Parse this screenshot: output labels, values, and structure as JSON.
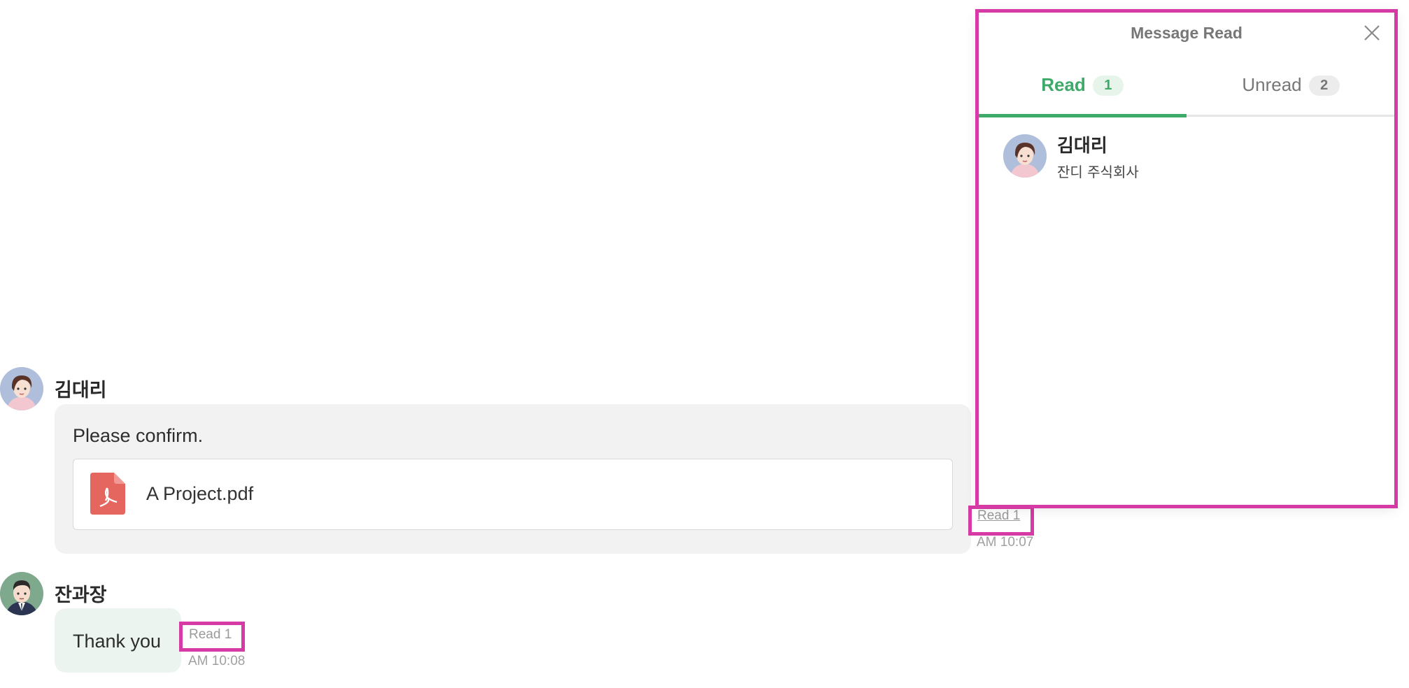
{
  "messages": [
    {
      "sender": "김대리",
      "text": "Please confirm.",
      "attachment": {
        "file_name": "A Project.pdf",
        "icon": "pdf-file-icon"
      },
      "read_label": "Read 1",
      "time": "AM 10:07"
    },
    {
      "sender": "잔과장",
      "text": "Thank you",
      "read_label": "Read 1",
      "time": "AM 10:08"
    }
  ],
  "panel": {
    "title": "Message Read",
    "close_icon": "close-icon",
    "tabs": [
      {
        "label": "Read",
        "count": "1",
        "active": true
      },
      {
        "label": "Unread",
        "count": "2",
        "active": false
      }
    ],
    "members": [
      {
        "name": "김대리",
        "company": "잔디 주식회사"
      }
    ]
  },
  "colors": {
    "accent": "#3daa6a",
    "highlight": "#d63aa4",
    "bubble_gray": "#f2f2f2",
    "bubble_green": "#ecf4ef",
    "pdf_red": "#e5665f"
  }
}
